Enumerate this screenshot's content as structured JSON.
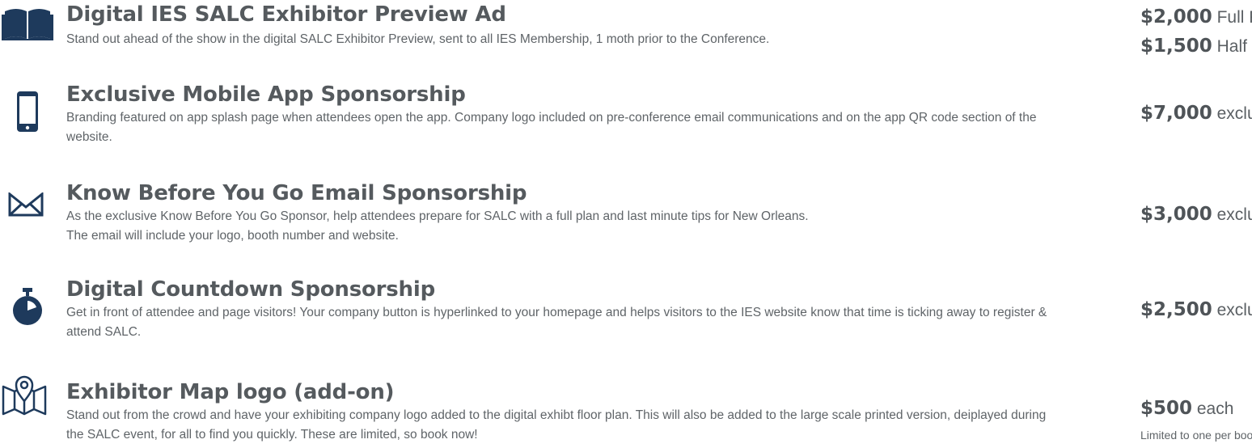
{
  "colors": {
    "icon": "#1e3a5c",
    "text": "#5a5f63"
  },
  "items": [
    {
      "icon": "book-icon",
      "title": "Digital IES SALC Exhibitor Preview Ad",
      "description": "Stand out ahead of the show in the digital SALC Exhibitor Preview, sent to all IES Membership, 1 moth prior to the Conference.",
      "prices": [
        {
          "amount": "$2,000",
          "unit": "Full Page"
        },
        {
          "amount": "$1,500",
          "unit": "Half Page"
        }
      ]
    },
    {
      "icon": "mobile-phone-icon",
      "title": "Exclusive Mobile App Sponsorship",
      "description": "Branding featured on app splash page when attendees open the app. Company logo included on pre-conference email communications and on the app QR code section of the website.",
      "prices": [
        {
          "amount": "$7,000",
          "unit": "exclusive"
        }
      ]
    },
    {
      "icon": "envelope-icon",
      "title": "Know Before You Go Email Sponsorship",
      "description_lines": [
        "As the exclusive Know Before You Go Sponsor, help attendees prepare for SALC with a full plan and last minute tips for New Orleans.",
        "The email will include your logo, booth number and website."
      ],
      "prices": [
        {
          "amount": "$3,000",
          "unit": "exclusive"
        }
      ]
    },
    {
      "icon": "stopwatch-icon",
      "title": "Digital Countdown Sponsorship",
      "description": "Get in front of attendee and page visitors! Your company button is hyperlinked to your homepage and helps visitors to the IES website know that time is ticking away to register & attend SALC.",
      "prices": [
        {
          "amount": "$2,500",
          "unit": "exclusive"
        }
      ]
    },
    {
      "icon": "map-pin-icon",
      "title": "Exhibitor Map logo (add-on)",
      "description": "Stand out from the crowd and have your exhibiting company logo added to the digital exhibt floor plan. This will also be added to the large scale printed version, deiplayed during the SALC event, for all to find you quickly. These are limited, so book now!",
      "prices": [
        {
          "amount": "$500",
          "unit": "each"
        }
      ],
      "note": "Limited to one per booth"
    }
  ]
}
